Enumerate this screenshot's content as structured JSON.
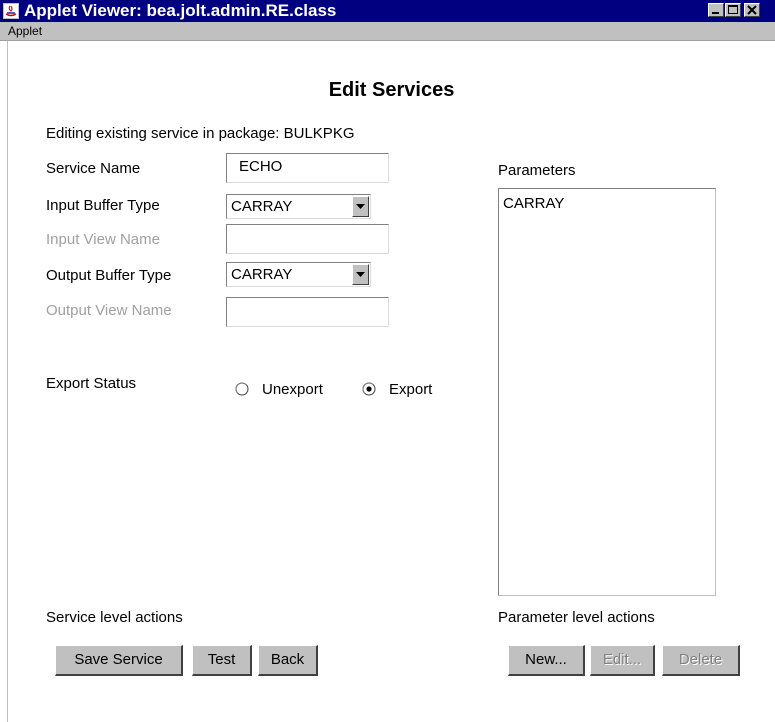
{
  "window": {
    "title": "Applet Viewer: bea.jolt.admin.RE.class",
    "icon": "java-applet-icon",
    "controls": [
      "minimize",
      "maximize",
      "close"
    ]
  },
  "menubar": {
    "items": [
      "Applet"
    ]
  },
  "form": {
    "heading": "Edit Services",
    "context_text": "Editing existing service in package: BULKPKG",
    "service_name": {
      "label": "Service Name",
      "value": "ECHO"
    },
    "input_buffer_type": {
      "label": "Input Buffer Type",
      "value": "CARRAY"
    },
    "input_view_name": {
      "label": "Input View Name",
      "value": "",
      "enabled": false
    },
    "output_buffer_type": {
      "label": "Output Buffer Type",
      "value": "CARRAY"
    },
    "output_view_name": {
      "label": "Output View Name",
      "value": "",
      "enabled": false
    },
    "export_status": {
      "label": "Export Status",
      "options": [
        {
          "label": "Unexport",
          "selected": false
        },
        {
          "label": "Export",
          "selected": true
        }
      ]
    }
  },
  "parameters": {
    "label": "Parameters",
    "items": [
      "CARRAY"
    ]
  },
  "service_actions": {
    "label": "Service level actions",
    "buttons": [
      {
        "label": "Save Service",
        "enabled": true
      },
      {
        "label": "Test",
        "enabled": true
      },
      {
        "label": "Back",
        "enabled": true
      }
    ]
  },
  "parameter_actions": {
    "label": "Parameter level actions",
    "buttons": [
      {
        "label": "New...",
        "enabled": true
      },
      {
        "label": "Edit...",
        "enabled": false
      },
      {
        "label": "Delete",
        "enabled": false
      }
    ]
  },
  "colors": {
    "titlebar": "#000080",
    "face": "#c0c0c0",
    "disabled_text": "#a0a0a0"
  }
}
